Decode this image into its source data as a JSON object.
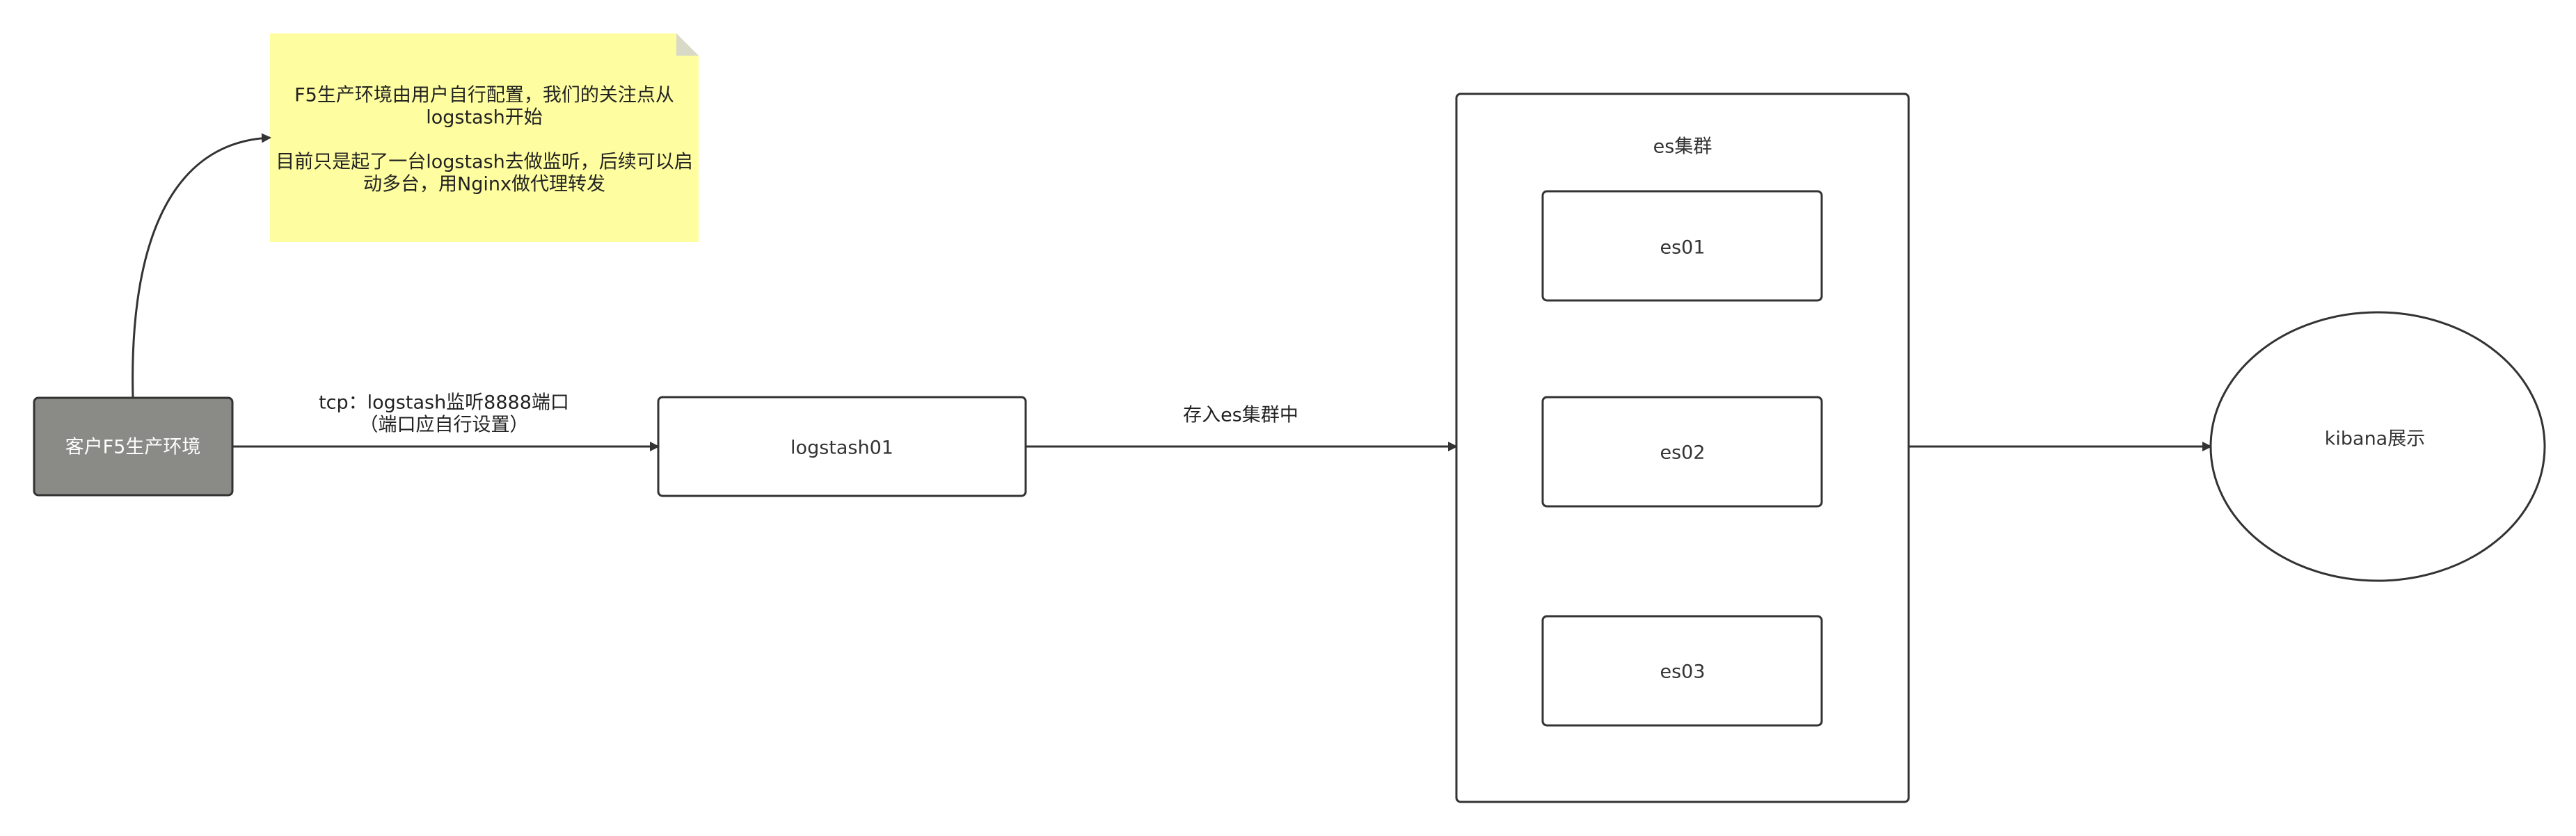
{
  "nodes": {
    "client": {
      "label": "客户F5生产环境"
    },
    "logstash": {
      "label": "logstash01"
    },
    "cluster": {
      "label": "es集群"
    },
    "es01": {
      "label": "es01"
    },
    "es02": {
      "label": "es02"
    },
    "es03": {
      "label": "es03"
    },
    "kibana": {
      "label": "kibana展示"
    }
  },
  "note": {
    "lines": [
      "F5生产环境由用户自行配置，我们的关注点从",
      "logstash开始",
      "目前只是起了一台logstash去做监听，后续可以启",
      "动多台，用Nginx做代理转发"
    ]
  },
  "edges": {
    "client_to_logstash": {
      "line1": "tcp：logstash监听8888端口",
      "line2": "（端口应自行设置）"
    },
    "logstash_to_cluster": {
      "label": "存入es集群中"
    }
  },
  "colors": {
    "stroke": "#333333",
    "client_fill": "#8a8a86",
    "note_fill": "#fefea0",
    "note_fold": "#d9d9c8"
  }
}
